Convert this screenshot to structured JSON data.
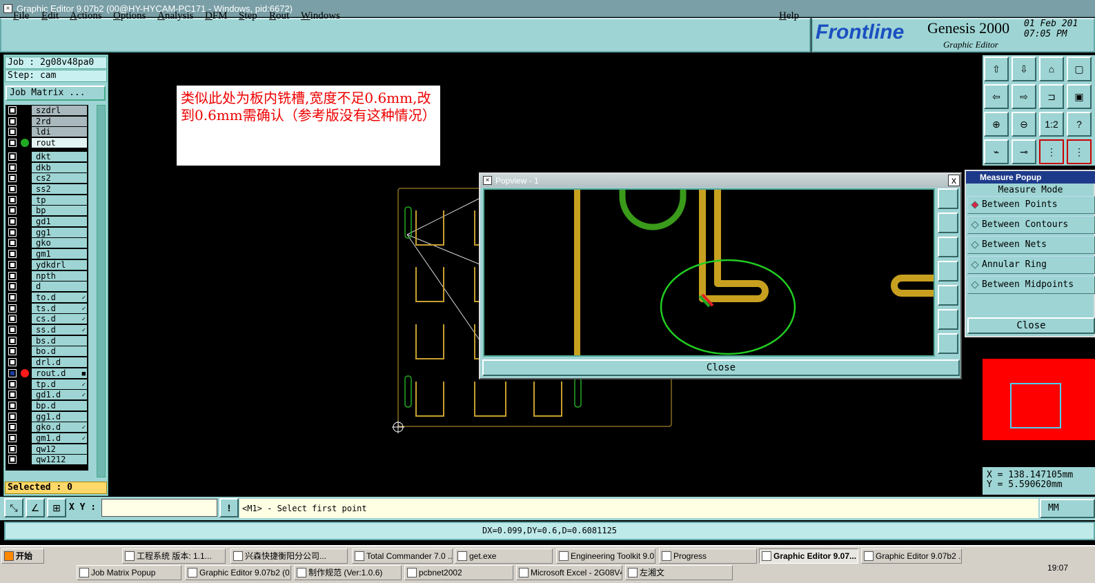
{
  "window": {
    "title": "Graphic Editor 9.07b2 (00@HY-HYCAM-PC171 - Windows, pid:6672)"
  },
  "menu": [
    "File",
    "Edit",
    "Actions",
    "Options",
    "Analysis",
    "DFM",
    "Step",
    "Rout",
    "Windows"
  ],
  "help_label": "Help",
  "brand": {
    "logo": "Frontline",
    "product": "Genesis 2000",
    "subtitle": "Graphic Editor",
    "date": "01 Feb 201",
    "time": "07:05 PM"
  },
  "job": {
    "job_line": "Job : 2g08v48pa0",
    "step_line": "Step: cam",
    "matrix_button": "Job Matrix ..."
  },
  "layers": [
    {
      "name": "szdrl",
      "style": "gray"
    },
    {
      "name": "2rd",
      "style": "gray"
    },
    {
      "name": "ldi",
      "style": "gray"
    },
    {
      "name": "rout",
      "style": "light",
      "dot": "#22aa22"
    },
    {
      "name": "dkt"
    },
    {
      "name": "dkb"
    },
    {
      "name": "cs2"
    },
    {
      "name": "ss2"
    },
    {
      "name": "tp"
    },
    {
      "name": "bp"
    },
    {
      "name": "gd1"
    },
    {
      "name": "gg1"
    },
    {
      "name": "gko"
    },
    {
      "name": "gm1"
    },
    {
      "name": "ydkdrl"
    },
    {
      "name": "npth"
    },
    {
      "name": "d"
    },
    {
      "name": "to.d",
      "tick": "✓"
    },
    {
      "name": "ts.d",
      "tick": "✓"
    },
    {
      "name": "cs.d",
      "tick": "✓"
    },
    {
      "name": "ss.d",
      "tick": "✓"
    },
    {
      "name": "bs.d"
    },
    {
      "name": "bo.d"
    },
    {
      "name": "drl.d"
    },
    {
      "name": "rout.d",
      "dot": "#ff1a1a",
      "tick": "■",
      "blue": true
    },
    {
      "name": "tp.d",
      "tick": "✓"
    },
    {
      "name": "gd1.d",
      "tick": "✓"
    },
    {
      "name": "bp.d"
    },
    {
      "name": "gg1.d"
    },
    {
      "name": "gko.d",
      "tick": "✓"
    },
    {
      "name": "gm1.d",
      "tick": "✓"
    },
    {
      "name": "qw12"
    },
    {
      "name": "qw1212"
    }
  ],
  "selected": "Selected : 0",
  "note": "类似此处为板内铣槽,宽度不足0.6mm,改到0.6mm需确认（参考版没有这种情况）",
  "popview": {
    "title": "Popview - 1",
    "close_label": "Close",
    "close_x": "x"
  },
  "measure": {
    "title": "Measure Popup",
    "mode_label": "Measure Mode",
    "options": [
      "Between Points",
      "Between Contours",
      "Between Nets",
      "Annular Ring",
      "Between Midpoints"
    ],
    "selected_option": "Between Points",
    "close_label": "Close"
  },
  "coords": {
    "x": "X = 138.147105mm",
    "y": "Y = 5.590620mm"
  },
  "bottom": {
    "xy_label": "X Y :",
    "prompt": "<M1> - Select first point",
    "units": "MM",
    "exclaim": "!"
  },
  "dx_readout": "DX=0.099,DY=0.6,D=0.6081125",
  "taskbar": {
    "start": "开始",
    "row1": [
      "工程系统  版本: 1.1...",
      "兴森快捷衡阳分公司...",
      "Total Commander 7.0 ...",
      "get.exe",
      "Engineering Toolkit 9.0...",
      "Progress",
      "Graphic Editor 9.07...",
      "Graphic Editor 9.07b2 ..."
    ],
    "row2": [
      "Job Matrix Popup",
      "Graphic Editor 9.07b2 (0...",
      "制作规范 (Ver:1.0.6)",
      "pcbnet2002",
      "Microsoft Excel - 2G08V4...",
      "左湘文"
    ],
    "active": "Graphic Editor 9.07...",
    "clock": "19:07"
  }
}
